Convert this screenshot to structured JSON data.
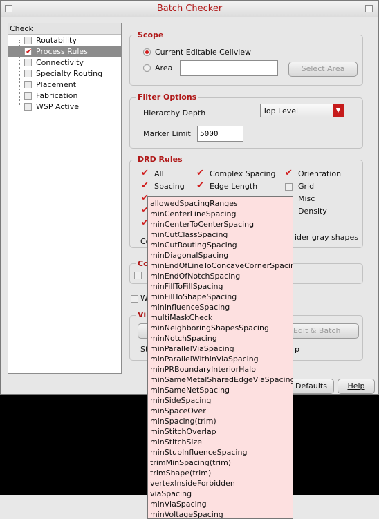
{
  "window": {
    "title": "Batch Checker"
  },
  "tree": {
    "header": "Check",
    "items": [
      {
        "label": "Routability",
        "checked": false,
        "selected": false
      },
      {
        "label": "Process Rules",
        "checked": true,
        "selected": true
      },
      {
        "label": "Connectivity",
        "checked": false,
        "selected": false
      },
      {
        "label": "Specialty Routing",
        "checked": false,
        "selected": false
      },
      {
        "label": "Placement",
        "checked": false,
        "selected": false
      },
      {
        "label": "Fabrication",
        "checked": false,
        "selected": false
      },
      {
        "label": "WSP Active",
        "checked": false,
        "selected": false
      }
    ]
  },
  "scope": {
    "title": "Scope",
    "current_label": "Current Editable Cellview",
    "area_label": "Area",
    "area_value": "",
    "select_area_label": "Select Area"
  },
  "filter": {
    "title": "Filter Options",
    "hierarchy_label": "Hierarchy Depth",
    "hierarchy_value": "Top Level",
    "marker_label": "Marker Limit",
    "marker_value": "5000"
  },
  "drd": {
    "title": "DRD Rules",
    "checks": {
      "all": "All",
      "complex_spacing": "Complex Spacing",
      "orientation": "Orientation",
      "spacing": "Spacing",
      "edge_length": "Edge Length",
      "grid": "Grid",
      "misc": "Misc",
      "density": "Density"
    },
    "partial_co": "Co",
    "partial_gray": "ider gray shapes"
  },
  "partial": {
    "co2": "Co",
    "w_label": "W",
    "vi": "Vi",
    "edit_batch": "Edit & Batch",
    "st": "St",
    "p": "p"
  },
  "footer": {
    "defaults_label": "Defaults",
    "help_label": "Help"
  },
  "dropdown": {
    "items": [
      "allowedSpacingRanges",
      "minCenterLineSpacing",
      "minCenterToCenterSpacing",
      "minCutClassSpacing",
      "minCutRoutingSpacing",
      "minDiagonalSpacing",
      "minEndOfLineToConcaveCornerSpacing",
      "minEndOfNotchSpacing",
      "minFillToFillSpacing",
      "minFillToShapeSpacing",
      "minInfluenceSpacing",
      "multiMaskCheck",
      "minNeighboringShapesSpacing",
      "minNotchSpacing",
      "minParallelViaSpacing",
      "minParallelWithinViaSpacing",
      "minPRBoundaryInteriorHalo",
      "minSameMetalSharedEdgeViaSpacing",
      "minSameNetSpacing",
      "minSideSpacing",
      "minSpaceOver",
      "minSpacing(trim)",
      "minStitchOverlap",
      "minStitchSize",
      "minStubInfluenceSpacing",
      "trimMinSpacing(trim)",
      "trimShape(trim)",
      "vertexInsideForbidden",
      "viaSpacing",
      "minViaSpacing",
      "minVoltageSpacing"
    ]
  },
  "colors": {
    "accent": "#b01818",
    "check": "#d01b1b",
    "dropdown_bg": "#fde0e0"
  }
}
